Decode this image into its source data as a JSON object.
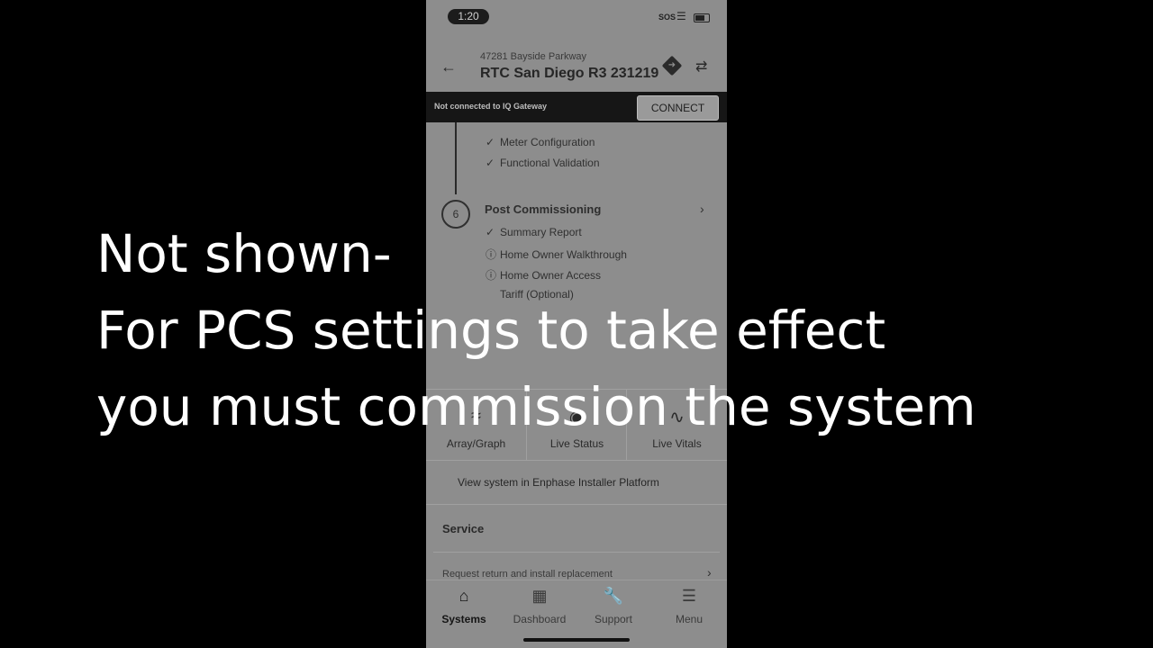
{
  "status_bar": {
    "time": "1:20",
    "sos": "SOS"
  },
  "header": {
    "address": "47281 Bayside Parkway",
    "title": "RTC San Diego R3 231219"
  },
  "gateway": {
    "message": "Not connected to IQ Gateway",
    "connect_label": "CONNECT"
  },
  "steps_prev": [
    {
      "label": "Meter Configuration",
      "status": "done"
    },
    {
      "label": "Functional Validation",
      "status": "done"
    }
  ],
  "post_commissioning": {
    "number": "6",
    "title": "Post Commissioning",
    "items": [
      {
        "label": "Summary Report",
        "status": "done"
      },
      {
        "label": "Home Owner Walkthrough",
        "status": "warning"
      },
      {
        "label": "Home Owner Access",
        "status": "warning"
      },
      {
        "label": "Tariff (Optional)",
        "status": "none"
      }
    ]
  },
  "tiles": [
    {
      "label": "Array/Graph",
      "icon": "graph-icon"
    },
    {
      "label": "Live Status",
      "icon": "status-icon"
    },
    {
      "label": "Live Vitals",
      "icon": "vitals-icon"
    }
  ],
  "installer_link": "View system in Enphase Installer Platform",
  "service": {
    "title": "Service",
    "request": "Request return and install replacement"
  },
  "tabbar": [
    {
      "label": "Systems",
      "icon": "home-icon",
      "active": true
    },
    {
      "label": "Dashboard",
      "icon": "dashboard-icon",
      "active": false
    },
    {
      "label": "Support",
      "icon": "wrench-icon",
      "active": false
    },
    {
      "label": "Menu",
      "icon": "menu-icon",
      "active": false
    }
  ],
  "caption": {
    "line1": "Not shown-",
    "line2": "For PCS settings to take effect",
    "line3": "you must commission the system"
  }
}
